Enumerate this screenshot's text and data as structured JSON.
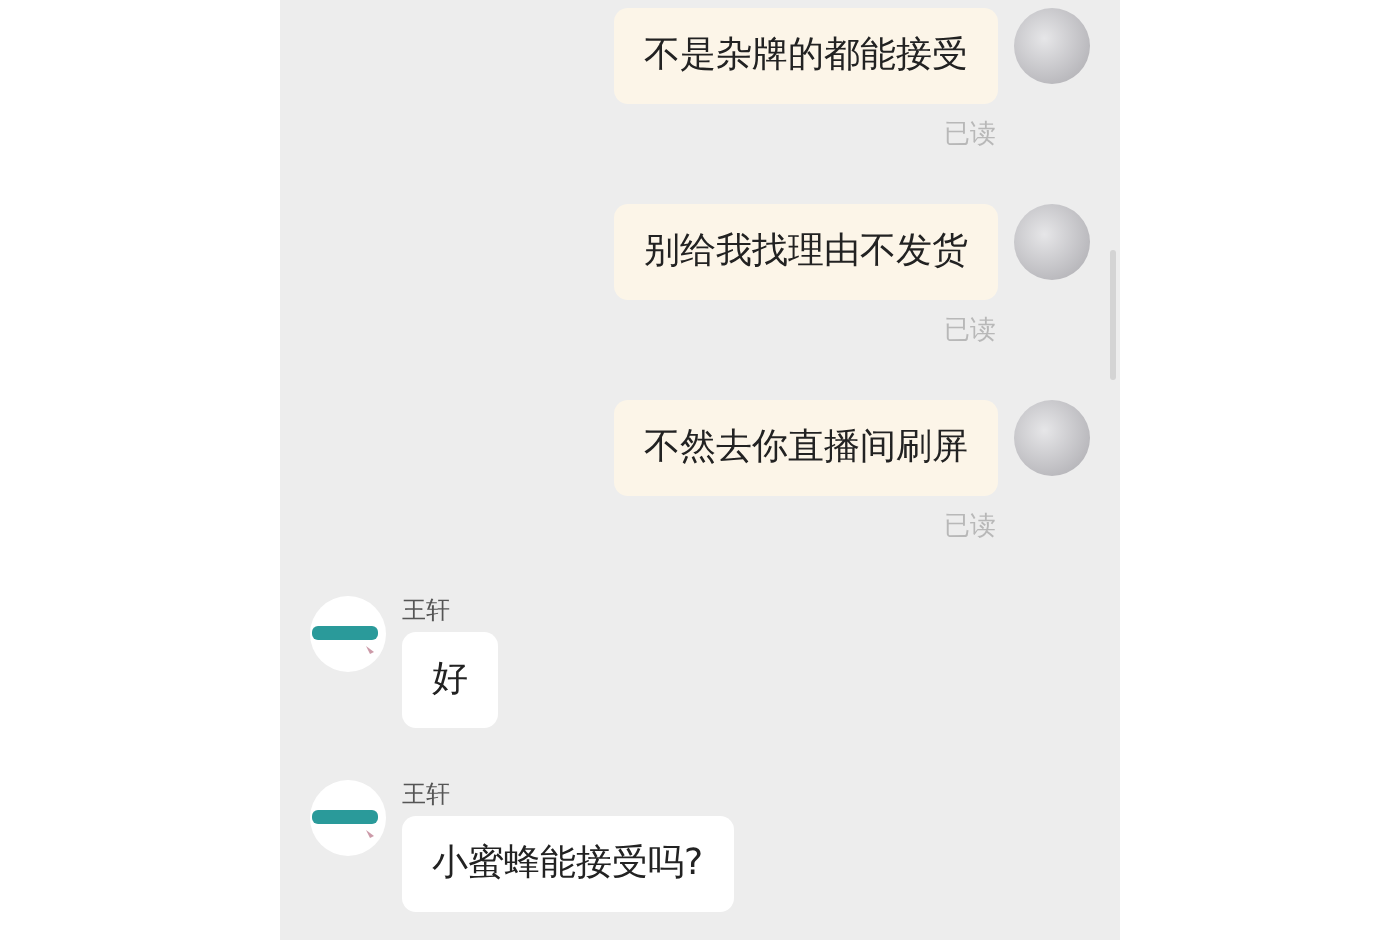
{
  "messages": [
    {
      "kind": "sent",
      "text": "不是杂牌的都能接受",
      "receipt": "已读"
    },
    {
      "kind": "sent",
      "text": "别给我找理由不发货",
      "receipt": "已读"
    },
    {
      "kind": "sent",
      "text": "不然去你直播间刷屏",
      "receipt": "已读"
    },
    {
      "kind": "received",
      "sender": "王轩",
      "text": "好"
    },
    {
      "kind": "received",
      "sender": "王轩",
      "text": "小蜜蜂能接受吗?"
    }
  ]
}
